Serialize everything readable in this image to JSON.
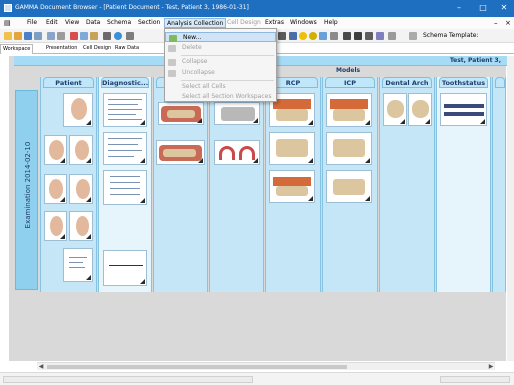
{
  "window": {
    "title": "GAMMA Document Browser - [Patient Document - Test, Patient 3, 1986-01-31]",
    "controls": [
      "–",
      "□",
      "✕"
    ]
  },
  "menubar": {
    "items": [
      "File",
      "Edit",
      "View",
      "Data",
      "Schema",
      "Section",
      "Analysis Collection",
      "Cell Design",
      "Extras",
      "Windows",
      "Help"
    ],
    "active_item": "Analysis Collection"
  },
  "toolbar": {
    "schema_template_label": "Schema Template:"
  },
  "tabs": [
    "Workspace",
    "Presentation",
    "Cell Design",
    "Raw Data"
  ],
  "dropdown": {
    "items": [
      {
        "label": "New...",
        "icon": "new-collection-icon",
        "state": "hover"
      },
      {
        "label": "Delete",
        "icon": "delete-icon",
        "state": "disabled"
      },
      {
        "label": "Collapse",
        "icon": "collapse-icon",
        "state": "disabled"
      },
      {
        "label": "Uncollapse",
        "icon": "uncollapse-icon",
        "state": "disabled"
      },
      {
        "label": "Select all Cells",
        "icon": "",
        "state": "disabled"
      },
      {
        "label": "Select all Section Workspaces",
        "icon": "",
        "state": "disabled"
      }
    ]
  },
  "document": {
    "test_header": "Test, Patient 3,",
    "group_header": "Models",
    "row_label": "Examination 2014-02-10",
    "columns": [
      "Patient",
      "Diagnostic...",
      "",
      "",
      "RCP",
      "ICP",
      "Dental Arch",
      "Toothstatus",
      ""
    ]
  },
  "colors": {
    "titlebar": "#1e6fbf",
    "grid_background": "#a9d8ef",
    "column_header": "#bfe6f9",
    "header_text": "#1f3d6d"
  }
}
